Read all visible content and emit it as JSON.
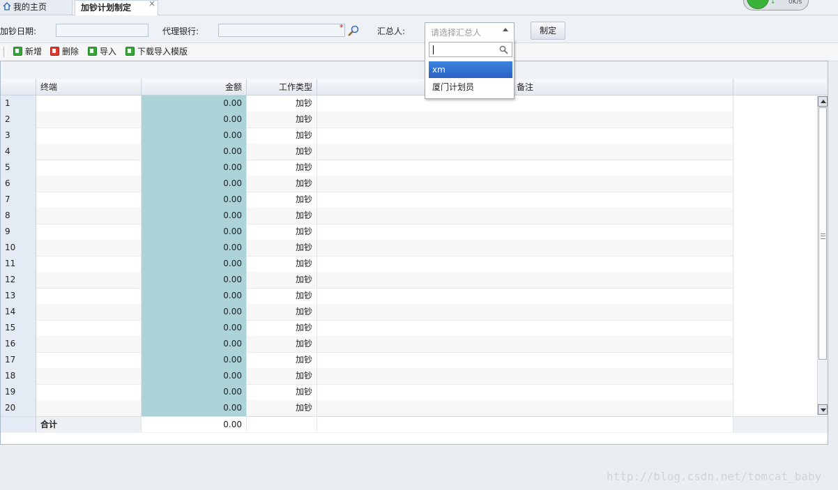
{
  "tabs": {
    "home": "我的主页",
    "active": "加钞计划制定",
    "close": "×"
  },
  "speed": {
    "value": "0K/s"
  },
  "filters": {
    "date_label": "加钞日期:",
    "bank_label": "代理银行:",
    "required_mark": "*",
    "summarizer_label": "汇总人:",
    "summarizer_placeholder": "请选择汇总人",
    "make_button": "制定"
  },
  "dropdown": {
    "options": [
      "xm",
      "厦门计划员"
    ],
    "selected": "xm"
  },
  "toolbar": {
    "add": "新增",
    "delete": "删除",
    "import": "导入",
    "download_template": "下载导入模版"
  },
  "grid": {
    "columns": [
      "终端",
      "金额",
      "工作类型",
      "备注"
    ],
    "rows": [
      {
        "idx": "1",
        "term": "",
        "amount": "0.00",
        "type": "加钞",
        "note": ""
      },
      {
        "idx": "2",
        "term": "",
        "amount": "0.00",
        "type": "加钞",
        "note": ""
      },
      {
        "idx": "3",
        "term": "",
        "amount": "0.00",
        "type": "加钞",
        "note": ""
      },
      {
        "idx": "4",
        "term": "",
        "amount": "0.00",
        "type": "加钞",
        "note": ""
      },
      {
        "idx": "5",
        "term": "",
        "amount": "0.00",
        "type": "加钞",
        "note": ""
      },
      {
        "idx": "6",
        "term": "",
        "amount": "0.00",
        "type": "加钞",
        "note": ""
      },
      {
        "idx": "7",
        "term": "",
        "amount": "0.00",
        "type": "加钞",
        "note": ""
      },
      {
        "idx": "8",
        "term": "",
        "amount": "0.00",
        "type": "加钞",
        "note": ""
      },
      {
        "idx": "9",
        "term": "",
        "amount": "0.00",
        "type": "加钞",
        "note": ""
      },
      {
        "idx": "10",
        "term": "",
        "amount": "0.00",
        "type": "加钞",
        "note": ""
      },
      {
        "idx": "11",
        "term": "",
        "amount": "0.00",
        "type": "加钞",
        "note": ""
      },
      {
        "idx": "12",
        "term": "",
        "amount": "0.00",
        "type": "加钞",
        "note": ""
      },
      {
        "idx": "13",
        "term": "",
        "amount": "0.00",
        "type": "加钞",
        "note": ""
      },
      {
        "idx": "14",
        "term": "",
        "amount": "0.00",
        "type": "加钞",
        "note": ""
      },
      {
        "idx": "15",
        "term": "",
        "amount": "0.00",
        "type": "加钞",
        "note": ""
      },
      {
        "idx": "16",
        "term": "",
        "amount": "0.00",
        "type": "加钞",
        "note": ""
      },
      {
        "idx": "17",
        "term": "",
        "amount": "0.00",
        "type": "加钞",
        "note": ""
      },
      {
        "idx": "18",
        "term": "",
        "amount": "0.00",
        "type": "加钞",
        "note": ""
      },
      {
        "idx": "19",
        "term": "",
        "amount": "0.00",
        "type": "加钞",
        "note": ""
      },
      {
        "idx": "20",
        "term": "",
        "amount": "0.00",
        "type": "加钞",
        "note": ""
      }
    ],
    "footer": {
      "label": "合计",
      "amount": "0.00"
    }
  },
  "watermark": "http://blog.csdn.net/tomcat_baby",
  "colors": {
    "amount_cell": "#abd3d8",
    "selected_option": "#3875d7"
  }
}
